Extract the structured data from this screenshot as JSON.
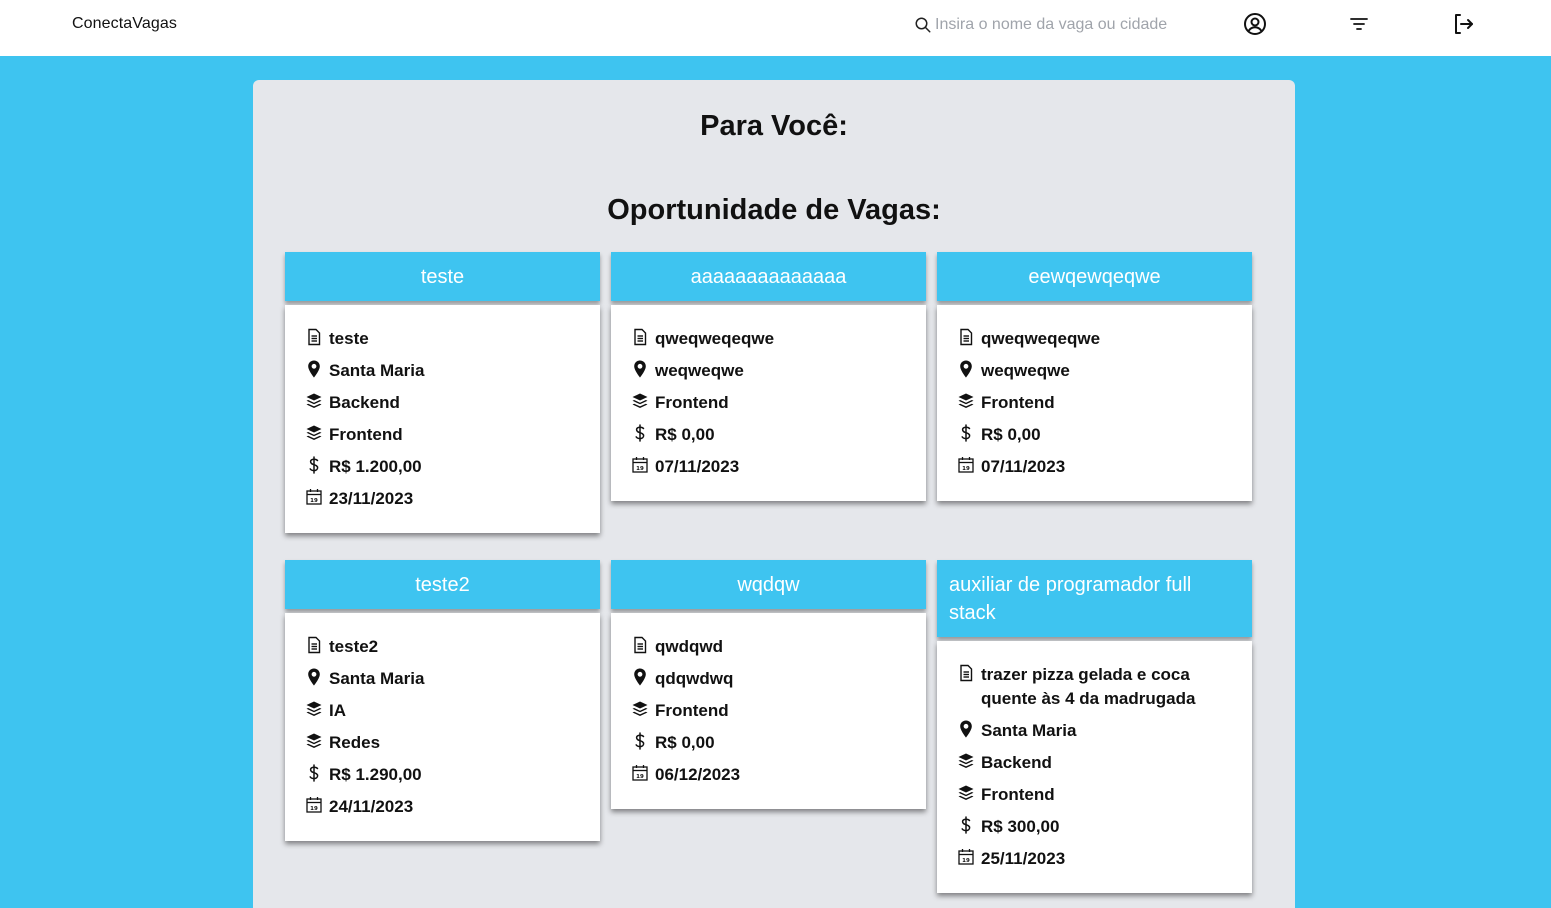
{
  "header": {
    "brand": "ConectaVagas",
    "search_placeholder": "Insira o nome da vaga ou cidade",
    "icons": [
      "search-icon",
      "user-circle-icon",
      "filter-icon",
      "logout-icon"
    ]
  },
  "main": {
    "title_for_you": "Para Você:",
    "title_opportunities": "Oportunidade de Vagas:"
  },
  "jobs": [
    {
      "title": "teste",
      "description": "teste",
      "location": "Santa Maria",
      "areas": [
        "Backend",
        "Frontend"
      ],
      "salary": "R$ 1.200,00",
      "date": "23/11/2023"
    },
    {
      "title": "aaaaaaaaaaaaaa",
      "description": "qweqweqeqwe",
      "location": "weqweqwe",
      "areas": [
        "Frontend"
      ],
      "salary": "R$ 0,00",
      "date": "07/11/2023"
    },
    {
      "title": "eewqewqeqwe",
      "description": "qweqweqeqwe",
      "location": "weqweqwe",
      "areas": [
        "Frontend"
      ],
      "salary": "R$ 0,00",
      "date": "07/11/2023"
    },
    {
      "title": "teste2",
      "description": "teste2",
      "location": "Santa Maria",
      "areas": [
        "IA",
        "Redes"
      ],
      "salary": "R$ 1.290,00",
      "date": "24/11/2023"
    },
    {
      "title": "wqdqw",
      "description": "qwdqwd",
      "location": "qdqwdwq",
      "areas": [
        "Frontend"
      ],
      "salary": "R$ 0,00",
      "date": "06/12/2023"
    },
    {
      "title": "auxiliar de programador full stack",
      "description": "trazer pizza gelada e coca quente às 4 da madrugada",
      "location": "Santa Maria",
      "areas": [
        "Backend",
        "Frontend"
      ],
      "salary": "R$ 300,00",
      "date": "25/11/2023"
    }
  ],
  "colors": {
    "background": "#3ec4f0",
    "panel": "#e5e7eb",
    "card_header": "#3ec4f0",
    "card_body": "#ffffff",
    "topbar": "#ffffff"
  }
}
